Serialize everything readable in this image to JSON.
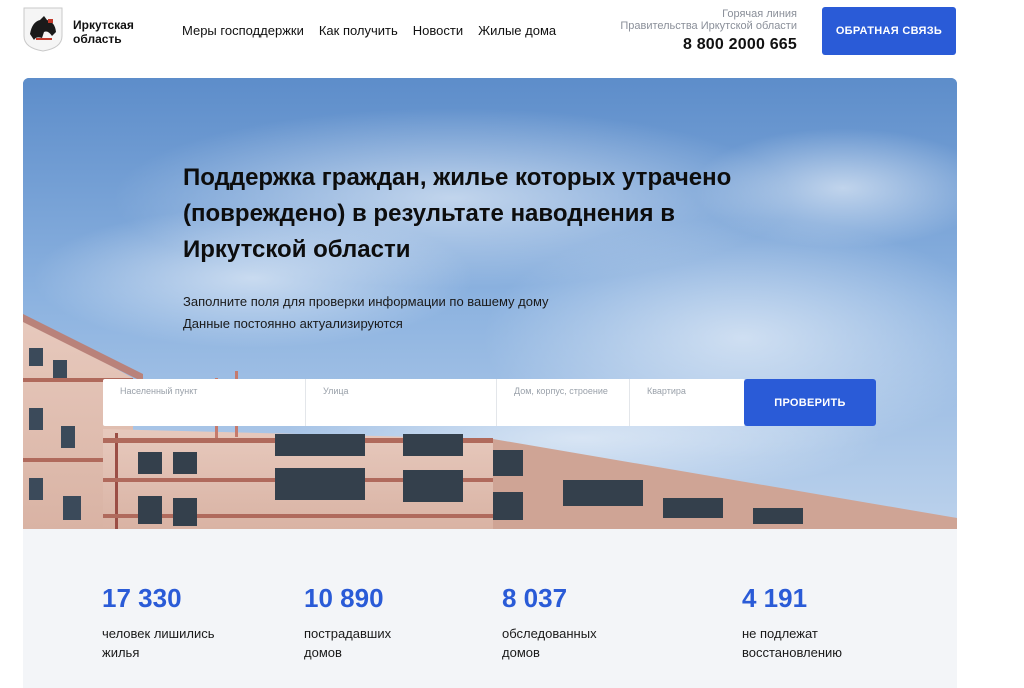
{
  "header": {
    "logo_text": "Иркутская область",
    "nav": [
      "Меры господдержки",
      "Как получить",
      "Новости",
      "Жилые дома"
    ],
    "hotline_label_1": "Горячая линия",
    "hotline_label_2": "Правительства Иркутской области",
    "hotline_phone": "8 800 2000 665",
    "feedback_label": "ОБРАТНАЯ СВЯЗЬ"
  },
  "hero": {
    "title": "Поддержка граждан, жилье которых утрачено (повреждено) в результате наводнения в Иркутской области",
    "subtitle_1": "Заполните поля для проверки информации по вашему дому",
    "subtitle_2": "Данные постоянно актуализируются",
    "fields": {
      "locality": "Населенный пункт",
      "street": "Улица",
      "house": "Дом, корпус, строение",
      "apartment": "Квартира"
    },
    "check_label": "ПРОВЕРИТЬ"
  },
  "stats": [
    {
      "value": "17 330",
      "label": "человек лишились жилья"
    },
    {
      "value": "10 890",
      "label": "пострадавших домов"
    },
    {
      "value": "8 037",
      "label": "обследованных домов"
    },
    {
      "value": "4 191",
      "label": "не подлежат восстановлению"
    }
  ],
  "colors": {
    "accent": "#2a5bd7",
    "stats_bg": "#f3f5f8"
  },
  "icons": {
    "logo": "irkutsk-coat-of-arms-icon"
  }
}
